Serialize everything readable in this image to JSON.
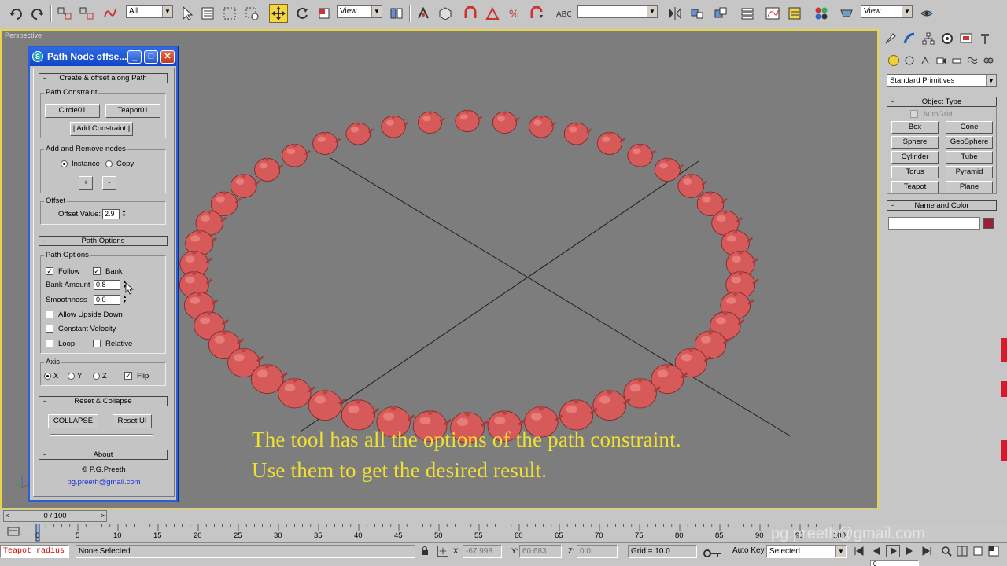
{
  "toolbar": {
    "selection_filter": "All",
    "ref_coord_1": "View",
    "named_selection": "",
    "ref_coord_2": "View"
  },
  "viewport": {
    "label": "Perspective",
    "caption_line1": "The tool has all the options of the path constraint.",
    "caption_line2": "Use them to get the desired result.",
    "object_color": "#d65a5a"
  },
  "dialog": {
    "title": "Path Node offse...",
    "rollouts": {
      "create": "Create & offset along Path",
      "path_options": "Path Options",
      "reset": "Reset & Collapse",
      "about": "About"
    },
    "path_constraint": {
      "group_label": "Path Constraint",
      "btn_path": "Circle01",
      "btn_object": "Teapot01",
      "btn_add": "| Add Constraint |"
    },
    "nodes": {
      "group_label": "Add and Remove nodes",
      "instance": "Instance",
      "copy": "Copy",
      "plus": "+",
      "minus": "-"
    },
    "offset": {
      "group_label": "Offset",
      "value_label": "Offset Value:",
      "value": "2.9"
    },
    "options": {
      "group_label": "Path Options",
      "follow": "Follow",
      "bank": "Bank",
      "bank_amount_label": "Bank Amount",
      "bank_amount": "0.8",
      "smoothness_label": "Smoothness",
      "smoothness": "0.0",
      "allow_upside_down": "Allow Upside Down",
      "constant_velocity": "Constant Velocity",
      "loop": "Loop",
      "relative": "Relative"
    },
    "axis": {
      "group_label": "Axis",
      "x": "X",
      "y": "Y",
      "z": "Z",
      "flip": "Flip"
    },
    "reset": {
      "collapse": "COLLAPSE",
      "reset_ui": "Reset UI"
    },
    "about": {
      "author": "© P.G.Preeth",
      "email": "pg.preeth@gmail.com"
    }
  },
  "command_panel": {
    "category": "Standard Primitives",
    "object_type": "Object Type",
    "autogrid": "AutoGrid",
    "primitives": [
      "Box",
      "Cone",
      "Sphere",
      "GeoSphere",
      "Cylinder",
      "Tube",
      "Torus",
      "Pyramid",
      "Teapot",
      "Plane"
    ],
    "name_and_color": "Name and Color",
    "name_value": "",
    "swatch_color": "#9b1d3a"
  },
  "timeline": {
    "frame_display": "0 / 100",
    "ticks": [
      "0",
      "5",
      "10",
      "15",
      "20",
      "25",
      "30",
      "35",
      "40",
      "45",
      "50",
      "55",
      "60",
      "65",
      "70",
      "75",
      "80",
      "85",
      "90",
      "95",
      "100"
    ]
  },
  "status": {
    "script_listener": "Teapot radius",
    "selection": "None Selected",
    "x_label": "X:",
    "x_value": "-67.998",
    "y_label": "Y:",
    "y_value": "60.683",
    "z_label": "Z:",
    "z_value": "0.0",
    "grid": "Grid = 10.0",
    "auto_key": "Auto Key",
    "key_mode": "Selected",
    "frame_field": "0"
  },
  "watermark": "pg.preeth@gmail.com"
}
